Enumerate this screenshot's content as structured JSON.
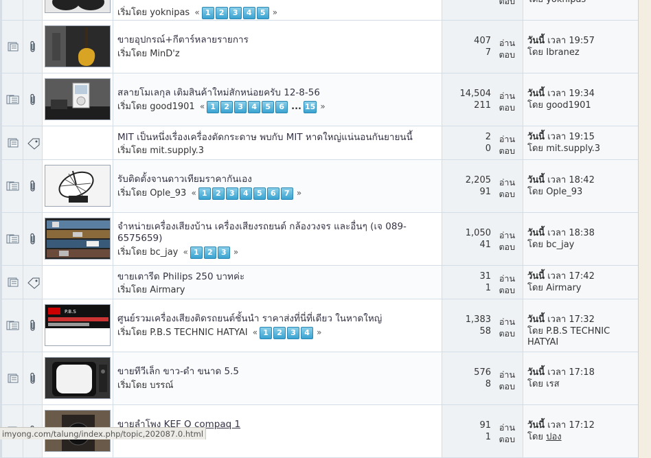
{
  "labels": {
    "started_by": "เริ่มโดย",
    "views": "อ่าน",
    "replies": "ตอบ",
    "today": "วันนี้",
    "at": "เวลา",
    "by": "โดย"
  },
  "status_bar": {
    "url": "imyong.com/talung/index.php/topic,202087.0.html"
  },
  "topics": [
    {
      "title": "",
      "starter": "yoknipas",
      "pages": [
        "1",
        "2",
        "3",
        "4",
        "5"
      ],
      "views": "",
      "replies": "",
      "last_time": "",
      "last_by": "yoknipas",
      "icon": "pages",
      "thumb": "headphones"
    },
    {
      "title": "ขายอุปกรณ์+กีตาร์หลายรายการ",
      "starter": "MinD'z",
      "pages": [],
      "views": "407",
      "replies": "7",
      "last_time": "19:57",
      "last_by": "Ibranez",
      "icon": "clip",
      "thumb": "guitar"
    },
    {
      "title": "สลายโมเลกุล เติมสินค้าใหม่สักหน่อยครับ 12-8-56",
      "starter": "good1901",
      "pages": [
        "1",
        "2",
        "3",
        "4",
        "5",
        "6",
        "...",
        "15"
      ],
      "views": "14,504",
      "replies": "211",
      "last_time": "19:34",
      "last_by": "good1901",
      "icon": "clip",
      "thumb": "ipod"
    },
    {
      "title": "MIT เป็นหนึ่งเรื่องเครื่องตัดกระดาษ พบกับ MIT หาดใหญ่แน่นอนกันยายนนี้",
      "starter": "mit.supply.3",
      "pages": [],
      "views": "2",
      "replies": "0",
      "last_time": "19:15",
      "last_by": "mit.supply.3",
      "icon": "tag",
      "thumb": ""
    },
    {
      "title": "รับติดตั้งจานดาวเทียมราคากันเอง",
      "starter": "Ople_93",
      "pages": [
        "1",
        "2",
        "3",
        "4",
        "5",
        "6",
        "7"
      ],
      "views": "2,205",
      "replies": "91",
      "last_time": "18:42",
      "last_by": "Ople_93",
      "icon": "clip",
      "thumb": "dish"
    },
    {
      "title": "จำหน่ายเครื่องเสียงบ้าน เครื่องเสียงรถยนต์ กล้องวงจร และอื่นๆ (เจ 089-6575659)",
      "starter": "bc_jay",
      "pages": [
        "1",
        "2",
        "3"
      ],
      "views": "1,050",
      "replies": "41",
      "last_time": "18:38",
      "last_by": "bc_jay",
      "icon": "clip",
      "thumb": "shelf"
    },
    {
      "title": "ขายเตารีด Philips 250 บาทค่ะ",
      "starter": "Airmary",
      "pages": [],
      "views": "31",
      "replies": "1",
      "last_time": "17:42",
      "last_by": "Airmary",
      "icon": "tag",
      "thumb": ""
    },
    {
      "title": "ศูนย์รวมเครื่องเสียงติดรถยนต์ชั้นนำ ราคาส่งที่นี่ที่เดียว ในหาดใหญ่",
      "starter": "P.B.S TECHNIC HATYAI",
      "pages": [
        "1",
        "2",
        "3",
        "4"
      ],
      "views": "1,383",
      "replies": "58",
      "last_time": "17:32",
      "last_by": "P.B.S TECHNIC HATYAI",
      "icon": "clip",
      "thumb": "banner"
    },
    {
      "title": "ขายทีวีเล็ก ขาว-ดำ ขนาด 5.5",
      "starter": "บรรณ์",
      "pages": [],
      "views": "576",
      "replies": "8",
      "last_time": "17:18",
      "last_by": "เรส",
      "icon": "clip",
      "thumb": "tv"
    },
    {
      "title": "ขายลำโพง KEF Q compaq 1",
      "starter": "",
      "pages": [],
      "views": "91",
      "replies": "1",
      "last_time": "17:12",
      "last_by": "ปอง",
      "icon": "clip",
      "thumb": "speaker"
    }
  ]
}
